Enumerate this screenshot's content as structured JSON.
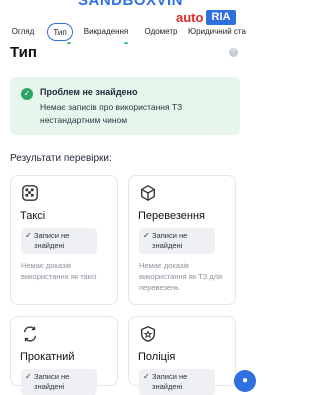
{
  "brand": {
    "logo_auto": "auto",
    "logo_ria": "RIA"
  },
  "tabs": [
    {
      "label": "Огляд"
    },
    {
      "label": "Тип"
    },
    {
      "label": "Викрадення"
    },
    {
      "label": "Одометр"
    },
    {
      "label": "Юридичний ста"
    }
  ],
  "page": {
    "title": "Тип",
    "help": "?"
  },
  "alert": {
    "title": "Проблем не знайдено",
    "text": "Немає записів про використання ТЗ нестандартним чином"
  },
  "section": {
    "title": "Результати перевірки:"
  },
  "cards": [
    {
      "title": "Таксі",
      "status": "Записи не знайдені",
      "desc": "Немає доказів використання як таксі",
      "icon": "taxi-icon"
    },
    {
      "title": "Перевезення",
      "status": "Записи не знайдені",
      "desc": "Немає доказів використання як ТЗ для перевезень",
      "icon": "box-icon"
    },
    {
      "title": "Прокатний",
      "status": "Записи не знайдені",
      "desc": "",
      "icon": "rental-icon"
    },
    {
      "title": "Поліція",
      "status": "Записи не знайдені",
      "desc": "",
      "icon": "police-badge-icon"
    }
  ],
  "colors": {
    "accent": "#2f6fe0",
    "success_bg": "#e6f6ec",
    "success": "#2ba364",
    "brand_red": "#db2828"
  }
}
